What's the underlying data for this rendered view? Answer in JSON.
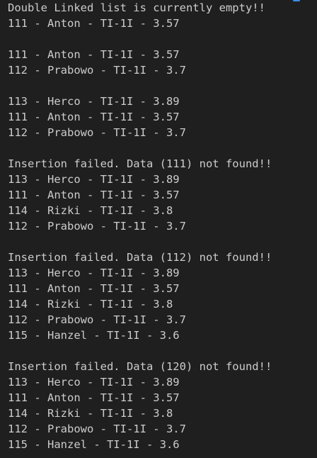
{
  "terminal": {
    "lines": [
      "Double Linked list is currently empty!!",
      "111 - Anton - TI-1I - 3.57",
      "",
      "111 - Anton - TI-1I - 3.57",
      "112 - Prabowo - TI-1I - 3.7",
      "",
      "113 - Herco - TI-1I - 3.89",
      "111 - Anton - TI-1I - 3.57",
      "112 - Prabowo - TI-1I - 3.7",
      "",
      "Insertion failed. Data (111) not found!!",
      "113 - Herco - TI-1I - 3.89",
      "111 - Anton - TI-1I - 3.57",
      "114 - Rizki - TI-1I - 3.8",
      "112 - Prabowo - TI-1I - 3.7",
      "",
      "Insertion failed. Data (112) not found!!",
      "113 - Herco - TI-1I - 3.89",
      "111 - Anton - TI-1I - 3.57",
      "114 - Rizki - TI-1I - 3.8",
      "112 - Prabowo - TI-1I - 3.7",
      "115 - Hanzel - TI-1I - 3.6",
      "",
      "Insertion failed. Data (120) not found!!",
      "113 - Herco - TI-1I - 3.89",
      "111 - Anton - TI-1I - 3.57",
      "114 - Rizki - TI-1I - 3.8",
      "112 - Prabowo - TI-1I - 3.7",
      "115 - Hanzel - TI-1I - 3.6"
    ]
  },
  "colors": {
    "background": "#1f1f1f",
    "text": "#cccccc",
    "accent": "#3b8eea"
  }
}
